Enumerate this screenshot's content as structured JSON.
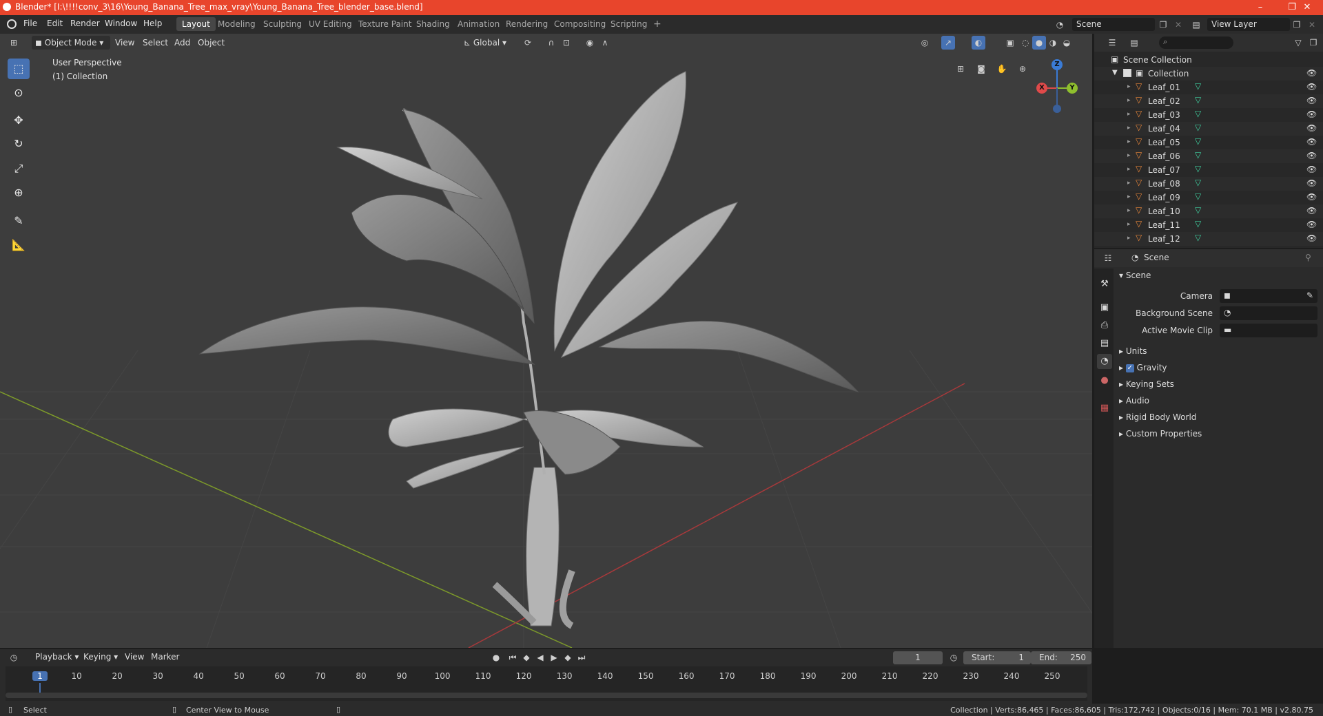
{
  "titlebar": {
    "title": "Blender* [I:\\!!!!conv_3\\16\\Young_Banana_Tree_max_vray\\Young_Banana_Tree_blender_base.blend]",
    "minimize": "–",
    "maximize": "❐",
    "close": "✕"
  },
  "menu": {
    "items": [
      "File",
      "Edit",
      "Render",
      "Window",
      "Help"
    ],
    "workspaces": [
      "Layout",
      "Modeling",
      "Sculpting",
      "UV Editing",
      "Texture Paint",
      "Shading",
      "Animation",
      "Rendering",
      "Compositing",
      "Scripting"
    ],
    "add_workspace": "+",
    "scene_name": "Scene",
    "view_layer": "View Layer"
  },
  "viewport_header": {
    "mode": "Object Mode",
    "view": "View",
    "select": "Select",
    "add": "Add",
    "object": "Object",
    "orientation": "Global"
  },
  "viewport": {
    "perspective_label": "User Perspective",
    "collection_label": "(1) Collection",
    "gizmo_axes": {
      "z": "Z",
      "x": "X",
      "y": "Y"
    },
    "colors": {
      "x_axis": "#e04a4a",
      "y_axis": "#8fbf2e",
      "z_axis": "#3a7bd5",
      "selection": "#4772b3"
    }
  },
  "outliner": {
    "root": "Scene Collection",
    "collection": "Collection",
    "items": [
      "Leaf_01",
      "Leaf_02",
      "Leaf_03",
      "Leaf_04",
      "Leaf_05",
      "Leaf_06",
      "Leaf_07",
      "Leaf_08",
      "Leaf_09",
      "Leaf_10",
      "Leaf_11",
      "Leaf_12"
    ],
    "visibility_icon": "eye-icon"
  },
  "properties": {
    "header": "Scene",
    "section": "Scene",
    "camera_label": "Camera",
    "background_scene_label": "Background Scene",
    "active_movie_clip_label": "Active Movie Clip",
    "panels": [
      "Units",
      "Gravity",
      "Keying Sets",
      "Audio",
      "Rigid Body World",
      "Custom Properties"
    ],
    "gravity_checked": true
  },
  "timeline": {
    "playback": "Playback",
    "keying": "Keying",
    "view": "View",
    "marker": "Marker",
    "current_frame": "1",
    "start_label": "Start:",
    "start": "1",
    "end_label": "End:",
    "end": "250",
    "ticks": [
      "1",
      "10",
      "20",
      "30",
      "40",
      "50",
      "60",
      "70",
      "80",
      "90",
      "100",
      "110",
      "120",
      "130",
      "140",
      "150",
      "160",
      "170",
      "180",
      "190",
      "200",
      "210",
      "220",
      "230",
      "240",
      "250"
    ]
  },
  "statusbar": {
    "select": "Select",
    "center_view": "Center View to Mouse",
    "stats": "Collection | Verts:86,465 | Faces:86,605 | Tris:172,742 | Objects:0/16 | Mem: 70.1 MB | v2.80.75"
  }
}
